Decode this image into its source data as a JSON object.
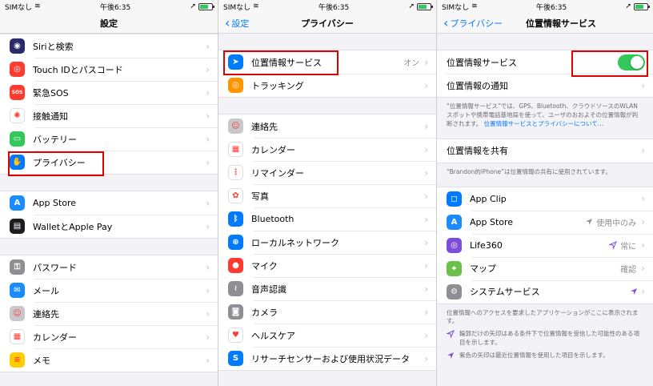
{
  "status": {
    "carrier": "SIMなし",
    "time": "午後6:35"
  },
  "colors": {
    "accent": "#007aff",
    "toggle_on": "#34c759",
    "highlight": "#e00000"
  },
  "panel1": {
    "title": "設定",
    "groups": [
      [
        {
          "label": "Siriと検索",
          "icon": "siri-icon",
          "color": "#2b2b6b"
        },
        {
          "label": "Touch IDとパスコード",
          "icon": "fingerprint-icon",
          "color": "#ff3b30"
        },
        {
          "label": "緊急SOS",
          "icon": "sos-icon",
          "color": "#ff3b30",
          "glyph": "SOS"
        },
        {
          "label": "接触通知",
          "icon": "exposure-icon",
          "color": "#ffffff"
        },
        {
          "label": "バッテリー",
          "icon": "battery-icon",
          "color": "#34c759"
        },
        {
          "label": "プライバシー",
          "icon": "hand-icon",
          "color": "#007aff"
        }
      ],
      [
        {
          "label": "App Store",
          "icon": "appstore-icon",
          "color": "#1a8cff"
        },
        {
          "label": "WalletとApple Pay",
          "icon": "wallet-icon",
          "color": "#1c1c1e"
        }
      ],
      [
        {
          "label": "パスワード",
          "icon": "key-icon",
          "color": "#8e8e93"
        },
        {
          "label": "メール",
          "icon": "mail-icon",
          "color": "#1a8cff"
        },
        {
          "label": "連絡先",
          "icon": "contacts-icon",
          "color": "#c7c7cc"
        },
        {
          "label": "カレンダー",
          "icon": "calendar-icon",
          "color": "#ffffff"
        },
        {
          "label": "メモ",
          "icon": "notes-icon",
          "color": "#ffcc00"
        }
      ]
    ]
  },
  "panel2": {
    "back": "設定",
    "title": "プライバシー",
    "top": {
      "label": "位置情報サービス",
      "value": "オン",
      "icon": "location-arrow-icon",
      "color": "#007aff"
    },
    "top2": {
      "label": "トラッキング",
      "icon": "tracking-icon",
      "color": "#ff9500"
    },
    "items": [
      {
        "label": "連絡先",
        "icon": "contacts-icon",
        "color": "#c7c7cc"
      },
      {
        "label": "カレンダー",
        "icon": "calendar-icon",
        "color": "#ffffff"
      },
      {
        "label": "リマインダー",
        "icon": "reminders-icon",
        "color": "#ffffff"
      },
      {
        "label": "写真",
        "icon": "photos-icon",
        "color": "#ffffff"
      },
      {
        "label": "Bluetooth",
        "icon": "bluetooth-icon",
        "color": "#007aff"
      },
      {
        "label": "ローカルネットワーク",
        "icon": "network-icon",
        "color": "#007aff"
      },
      {
        "label": "マイク",
        "icon": "mic-icon",
        "color": "#ff3b30"
      },
      {
        "label": "音声認識",
        "icon": "speech-icon",
        "color": "#8e8e93"
      },
      {
        "label": "カメラ",
        "icon": "camera-icon",
        "color": "#8e8e93"
      },
      {
        "label": "ヘルスケア",
        "icon": "health-icon",
        "color": "#ffffff"
      },
      {
        "label": "リサーチセンサーおよび使用状況データ",
        "icon": "research-icon",
        "color": "#007aff"
      }
    ]
  },
  "panel3": {
    "back": "プライバシー",
    "title": "位置情報サービス",
    "toggle_label": "位置情報サービス",
    "notify_label": "位置情報の通知",
    "note1": "“位置情報サービス”では、GPS、Bluetooth、クラウドソースのWLANスポットや携帯電話基地局を使って、ユーザのおおよその位置情報が判断されます。",
    "note1_link": "位置情報サービスとプライバシーについて…",
    "share_label": "位置情報を共有",
    "note2": "“Brandon的iPhone”は位置情報の共有に使用されています。",
    "apps": [
      {
        "label": "App Clip",
        "value": "",
        "icon": "appclip-icon",
        "color": "#007aff"
      },
      {
        "label": "App Store",
        "value": "使用中のみ",
        "icon": "appstore-icon",
        "color": "#1a8cff",
        "arrow": "gray"
      },
      {
        "label": "Life360",
        "value": "常に",
        "icon": "life360-icon",
        "color": "#7b4ddb",
        "arrow": "outline"
      },
      {
        "label": "マップ",
        "value": "確認",
        "icon": "maps-icon",
        "color": "#6cc04a"
      },
      {
        "label": "システムサービス",
        "value": "",
        "icon": "gear-icon",
        "color": "#8e8e93",
        "arrow": "purple"
      }
    ],
    "note3": "位置情報へのアクセスを要求したアプリケーションがここに表示されます。",
    "legend1": "輪郭だけの矢印はある条件下で位置情報を受信した可能性のある項目を示します。",
    "legend2": "紫色の矢印は最近位置情報を使用した項目を示します。"
  }
}
